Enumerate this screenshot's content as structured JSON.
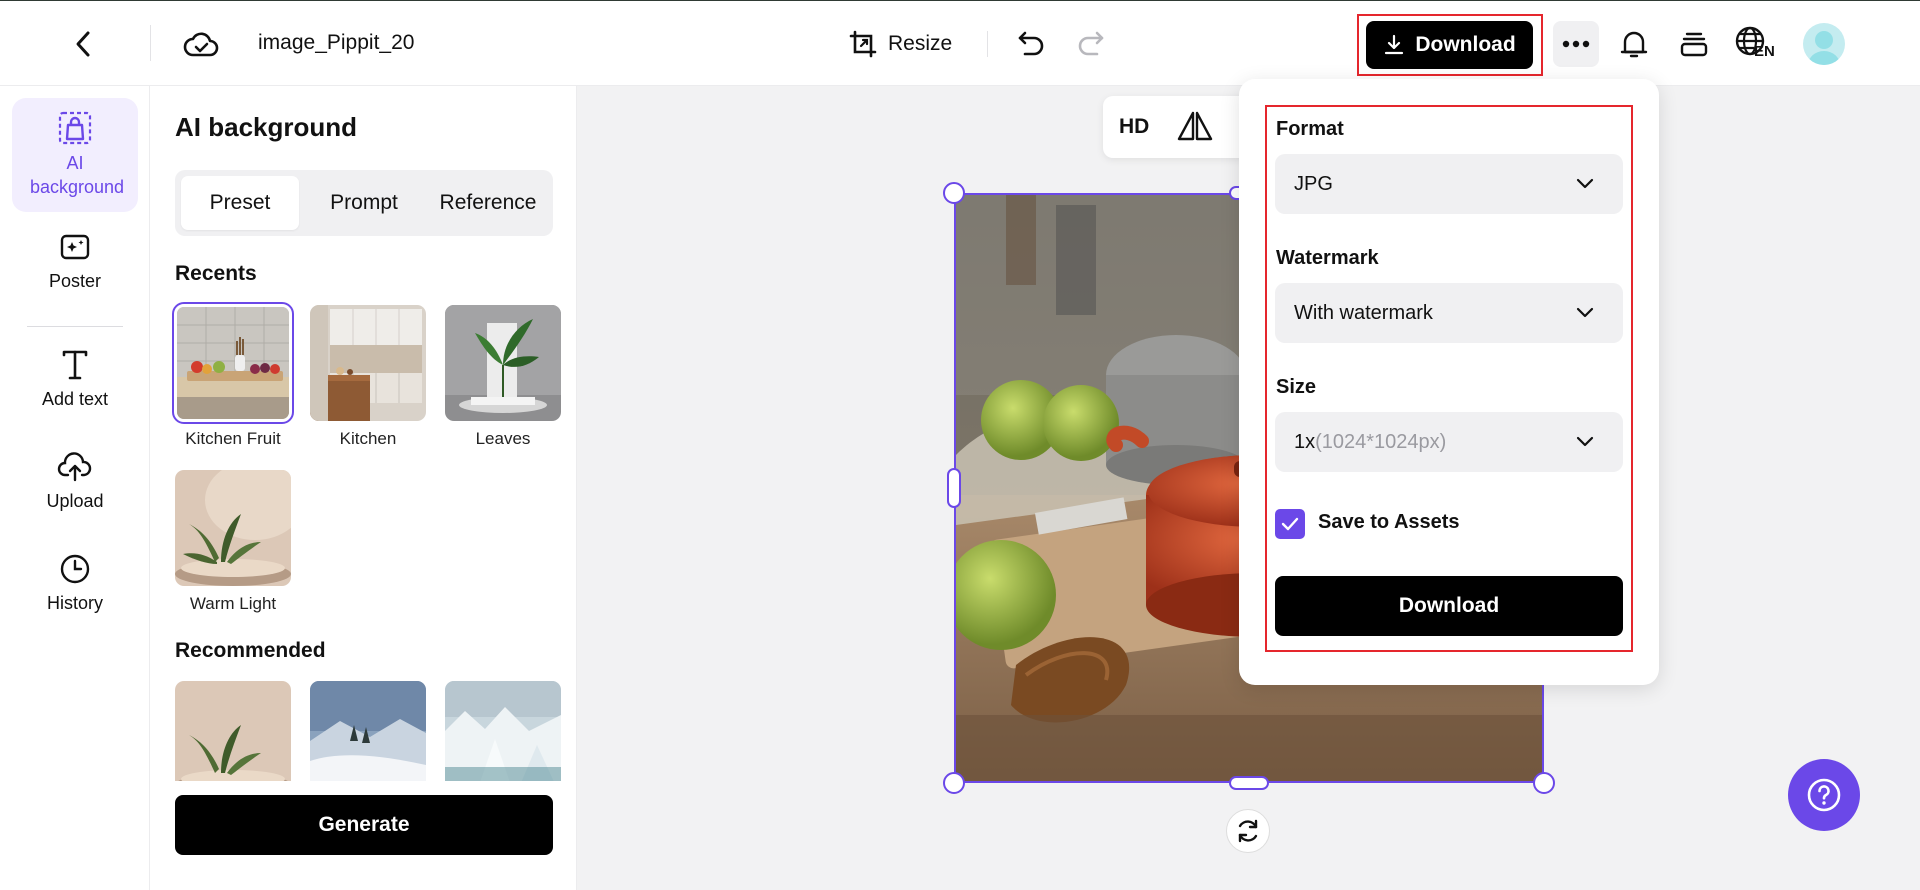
{
  "header": {
    "file_title": "image_Pippit_20",
    "resize_label": "Resize",
    "download_label": "Download",
    "language_code": "EN"
  },
  "rail": {
    "items": [
      {
        "label": "AI background",
        "icon": "ai-background-icon"
      },
      {
        "label": "Poster",
        "icon": "poster-icon"
      },
      {
        "label": "Add text",
        "icon": "text-icon"
      },
      {
        "label": "Upload",
        "icon": "upload-icon"
      },
      {
        "label": "History",
        "icon": "history-icon"
      }
    ]
  },
  "panel": {
    "title": "AI background",
    "tabs": [
      {
        "label": "Preset",
        "active": true
      },
      {
        "label": "Prompt",
        "active": false
      },
      {
        "label": "Reference",
        "active": false
      }
    ],
    "recents_title": "Recents",
    "recents": [
      {
        "name": "Kitchen Fruit",
        "selected": true
      },
      {
        "name": "Kitchen",
        "selected": false
      },
      {
        "name": "Leaves",
        "selected": false
      },
      {
        "name": "Warm Light",
        "selected": false
      }
    ],
    "recommended_title": "Recommended",
    "generate_label": "Generate"
  },
  "canvas": {
    "toolbar": {
      "hd_label": "HD"
    }
  },
  "download_popover": {
    "format_label": "Format",
    "format_value": "JPG",
    "watermark_label": "Watermark",
    "watermark_value": "With watermark",
    "size_label": "Size",
    "size_value": "1x",
    "size_hint": "(1024*1024px)",
    "save_to_assets_label": "Save to Assets",
    "save_to_assets_checked": true,
    "download_label": "Download"
  },
  "colors": {
    "accent": "#6b48e8",
    "highlight": "#e5262d",
    "primary_button": "#000000"
  }
}
